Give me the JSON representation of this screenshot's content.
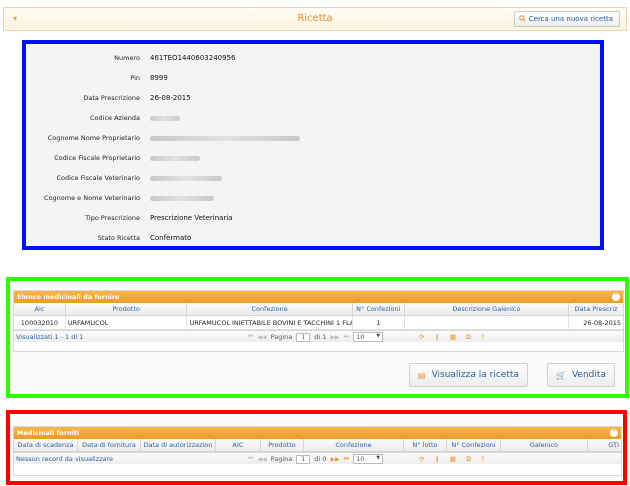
{
  "header": {
    "toggle_glyph": "▾",
    "title": "Ricetta",
    "search_button_label": "Cerca una nuova ricetta"
  },
  "details": [
    {
      "label": "Numero",
      "value": "461TEO1440603240956"
    },
    {
      "label": "Pin",
      "value": "8999"
    },
    {
      "label": "Data Prescrizione",
      "value": "26-08-2015"
    },
    {
      "label": "Codice Azienda",
      "value": ""
    },
    {
      "label": "Cognome Nome Proprietario",
      "value": ""
    },
    {
      "label": "Codice Fiscale Proprietario",
      "value": ""
    },
    {
      "label": "Codice Fiscale Veterinario",
      "value": ""
    },
    {
      "label": "Cognome e Nome Veterinario",
      "value": ""
    },
    {
      "label": "Tipo Prescrizione",
      "value": "Prescrizione Veterinaria"
    },
    {
      "label": "Stato Ricetta",
      "value": "Confermato"
    }
  ],
  "grid_to_supply": {
    "title": "Elenco medicinali da fornire",
    "columns": [
      "Aic",
      "Prodotto",
      "Confezione",
      "N° Confezioni",
      "Descrizione Galenico",
      "Data Prescriz"
    ],
    "rows": [
      [
        "100032010",
        "URFAMUCOL",
        "URFAMUCOL INIETTABILE BOVINI E TACCHINI 1 FLA",
        "1",
        "",
        "26-08-2015"
      ]
    ],
    "pager": {
      "info": "Visualizzati 1 - 1 di 1",
      "page_label": "Pagina",
      "page_value": "1",
      "of_label": "di 1",
      "page_size": "10"
    }
  },
  "actions": {
    "view_label": "Visualizza la ricetta",
    "sell_label": "Vendita"
  },
  "grid_supplied": {
    "title": "Medicinali forniti",
    "columns": [
      "Data di scadenza",
      "Data di fornitura",
      "Data di autorizzazion",
      "AIC",
      "Prodotto",
      "Confezione",
      "N° lotto",
      "N° Confezioni",
      "Galenico",
      "GTI"
    ],
    "pager": {
      "info": "Nessun record da visualizzare",
      "page_label": "Pagina",
      "page_value": "1",
      "of_label": "di 0",
      "page_size": "10"
    }
  },
  "icons": {
    "search": "search-icon",
    "collapse": "collapse-icon",
    "view": "document-icon",
    "sell": "cart-icon"
  },
  "colors": {
    "accent": "#e38d2a",
    "link": "#2c5c9a",
    "blue_frame": "#0010ff",
    "green_frame": "#2eff00",
    "red_frame": "#ff0000"
  }
}
